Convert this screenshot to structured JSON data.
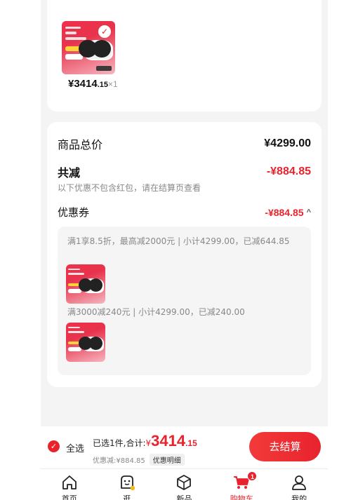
{
  "colors": {
    "accent": "#e8232e",
    "background": "#f4f4f4",
    "card": "#ffffff"
  },
  "product": {
    "image_icon": "product-thumbnail-icon",
    "price_symbol": "¥",
    "price_integer": "3414",
    "price_decimal": ".15",
    "quantity": "×1"
  },
  "summary": {
    "goods_total_label": "商品总价",
    "goods_total_value": "¥4299.00",
    "discount_label": "共减",
    "discount_value": "-¥884.85",
    "discount_note": "以下优惠不包含红包，请在结算页查看",
    "coupon_label": "优惠券",
    "coupon_value": "-¥884.85",
    "coupon_chevron_icon": "chevron-up-icon"
  },
  "coupon_details": [
    {
      "text": "满1享8.5折，最高减2000元 | 小计4299.00，已减644.85"
    },
    {
      "text": "满3000减240元 | 小计4299.00，已减240.00"
    }
  ],
  "checkout": {
    "select_all_label": "全选",
    "selected_summary": "已选1件,合计:",
    "total_symbol": "¥",
    "total_integer": "3414",
    "total_decimal": ".15",
    "discount_text": "优惠减:¥884.85",
    "detail_button": "优惠明细",
    "submit_button": "去结算"
  },
  "tabbar": {
    "items": [
      {
        "label": "首页",
        "icon": "home-icon"
      },
      {
        "label": "逛",
        "icon": "browse-icon"
      },
      {
        "label": "新品",
        "icon": "new-products-icon"
      },
      {
        "label": "购物车",
        "icon": "cart-icon",
        "active": true,
        "badge": "1"
      },
      {
        "label": "我的",
        "icon": "profile-icon"
      }
    ]
  }
}
